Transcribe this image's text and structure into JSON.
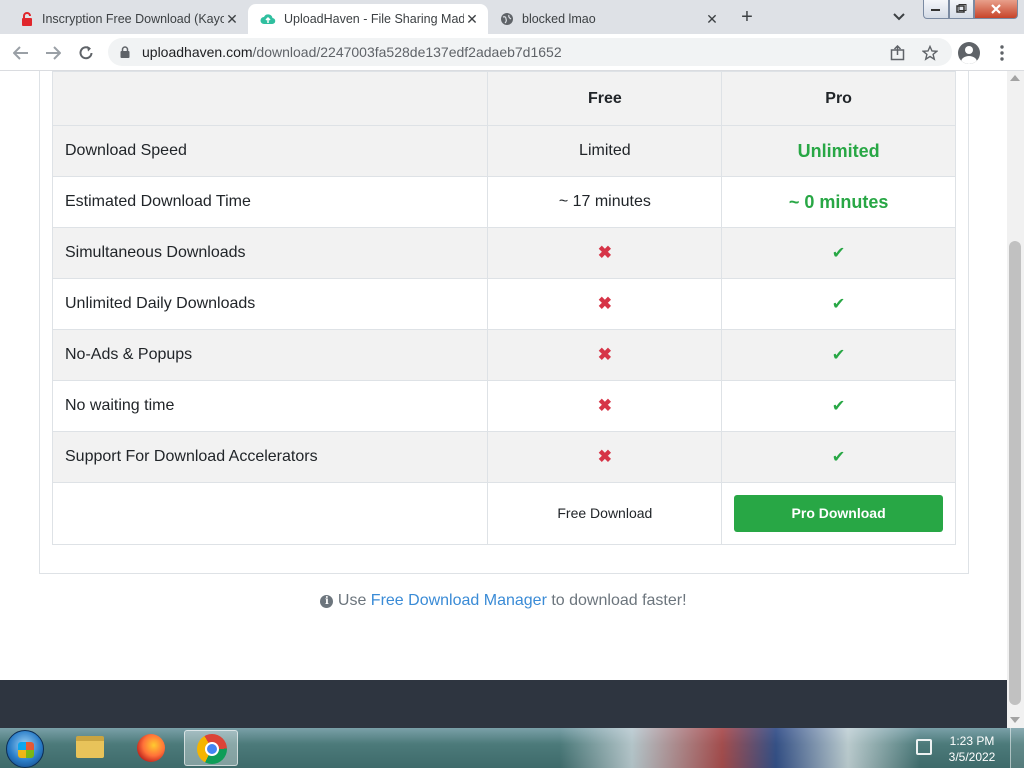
{
  "browser": {
    "tabs": [
      {
        "title": "Inscryption Free Download (Kayo",
        "close": "✕"
      },
      {
        "title": "UploadHaven - File Sharing Mad",
        "close": "✕"
      },
      {
        "title": "blocked lmao",
        "close": "✕"
      }
    ],
    "new_tab": "+",
    "url_host": "uploadhaven.com",
    "url_path": "/download/2247003fa528de137edf2adaeb7d1652"
  },
  "comparison": {
    "columns": {
      "free": "Free",
      "pro": "Pro"
    },
    "rows": [
      {
        "feature": "Download Speed",
        "free": "Limited",
        "pro": "Unlimited"
      },
      {
        "feature": "Estimated Download Time",
        "free": "~ 17 minutes",
        "pro": "~ 0 minutes"
      },
      {
        "feature": "Simultaneous Downloads",
        "free": "✖",
        "pro": "✔"
      },
      {
        "feature": "Unlimited Daily Downloads",
        "free": "✖",
        "pro": "✔"
      },
      {
        "feature": "No-Ads & Popups",
        "free": "✖",
        "pro": "✔"
      },
      {
        "feature": "No waiting time",
        "free": "✖",
        "pro": "✔"
      },
      {
        "feature": "Support For Download Accelerators",
        "free": "✖",
        "pro": "✔"
      }
    ],
    "free_download_label": "Free Download",
    "pro_download_label": "Pro Download"
  },
  "tip": {
    "prefix": "Use",
    "link": "Free Download Manager",
    "suffix": "to download faster!"
  },
  "taskbar": {
    "time": "1:23 PM",
    "date": "3/5/2022"
  },
  "colors": {
    "pro_green": "#28a745",
    "cross_red": "#d63447",
    "link_blue": "#3a8bd6"
  }
}
